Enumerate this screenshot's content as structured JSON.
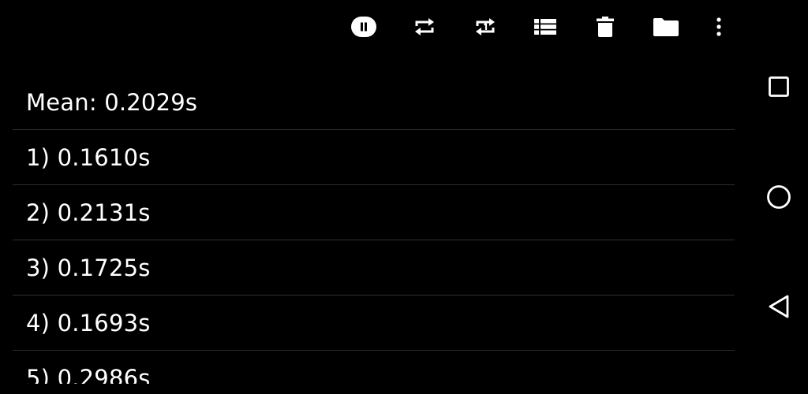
{
  "toolbar": {
    "icons": [
      "pause-icon",
      "repeat-icon",
      "repeat-one-icon",
      "list-view-icon",
      "delete-icon",
      "folder-icon",
      "more-vert-icon"
    ]
  },
  "results": {
    "mean": "Mean: 0.2029s",
    "laps": [
      "1) 0.1610s",
      "2) 0.2131s",
      "3) 0.1725s",
      "4) 0.1693s",
      "5) 0.2986s"
    ]
  },
  "navbar": {
    "icons": [
      "recents-square-icon",
      "home-circle-icon",
      "back-triangle-icon"
    ]
  }
}
